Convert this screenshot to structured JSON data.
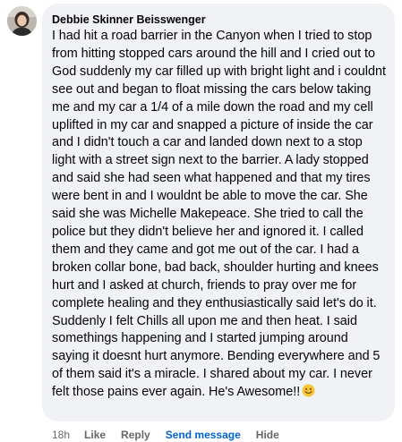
{
  "comment": {
    "author": "Debbie Skinner Beisswenger",
    "text": "I had hit a road barrier in the Canyon when I tried to stop from hitting stopped cars around the hill and I cried out to God suddenly my car filled up with bright light and i couldnt see out and began to float missing the cars below taking me and my car a 1/4 of a mile down the road and my cell uplifted in my car and snapped a picture of inside the car and I didn't touch a car and landed down next to a stop light with a street sign next to the barrier. A lady stopped and said she had seen what happened and that my tires were bent in and I wouldnt be able to move the car. She said she was Michelle Makepeace. She tried to call the police but they didn't believe her and ignored it. I called them and they came and got me out of the car. I had a broken collar bone, bad back, shoulder hurting and knees hurt and I asked at church, friends to pray over me for complete healing and they enthusiastically said let's do it. Suddenly I felt Chills all upon me and then heat. I said somethings happening and I started jumping around saying it doesnt hurt anymore. Bending everywhere and 5 of them said it's a miracle. I shared about my car. I never felt those pains ever again. He's Awesome!!",
    "emoji": "smiling-face-emoji"
  },
  "actions": {
    "time": "18h",
    "like": "Like",
    "reply": "Reply",
    "send_message": "Send message",
    "hide": "Hide"
  },
  "colors": {
    "bubble": "#f0f2f5",
    "text": "#050505",
    "secondary": "#65676b",
    "link": "#0064d1"
  }
}
